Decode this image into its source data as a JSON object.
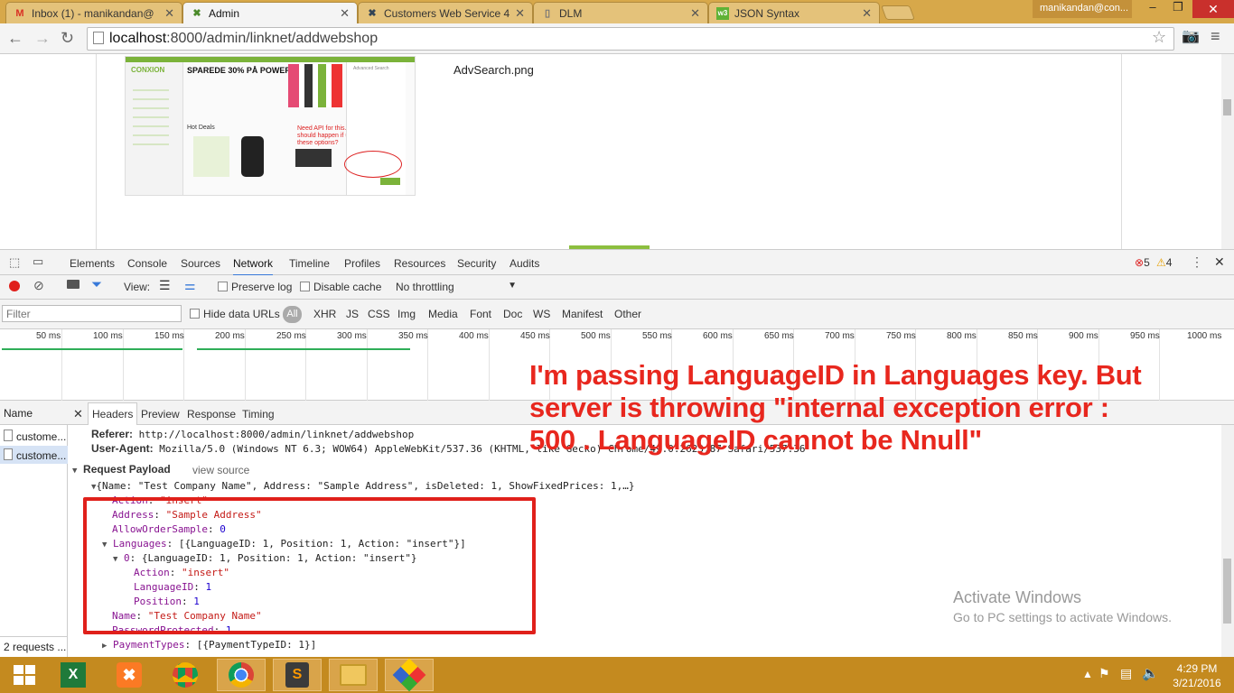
{
  "browser": {
    "tabs": [
      {
        "label": "Inbox (1) - manikandan@",
        "icon": "gmail-icon"
      },
      {
        "label": "Admin",
        "icon": "admin-icon"
      },
      {
        "label": "Customers Web Service 4",
        "icon": "x-icon"
      },
      {
        "label": "DLM",
        "icon": "page-icon"
      },
      {
        "label": "JSON Syntax",
        "icon": "w3-icon"
      }
    ],
    "active_tab": 1,
    "user_label": "manikandan@con...",
    "url_host": "localhost",
    "url_path": ":8000/admin/linknet/addwebshop"
  },
  "page": {
    "file_name": "AdvSearch.png",
    "thumbnail": {
      "brand": "CONXION",
      "banner": "SPAREDE 30% PÅ POWERBANK",
      "hot_deals": "Hot Deals",
      "note": "Need API for this. What should happen if user click these options?",
      "panel_title": "Advanced Search"
    }
  },
  "devtools": {
    "tabs": [
      "Elements",
      "Console",
      "Sources",
      "Network",
      "Timeline",
      "Profiles",
      "Resources",
      "Security",
      "Audits"
    ],
    "selected_tab": "Network",
    "errors": "5",
    "warnings": "4",
    "toolbar": {
      "view_label": "View:",
      "preserve_log": "Preserve log",
      "disable_cache": "Disable cache",
      "throttling": "No throttling"
    },
    "filter": {
      "placeholder": "Filter",
      "hide_data_urls": "Hide data URLs",
      "all": "All",
      "types": [
        "XHR",
        "JS",
        "CSS",
        "Img",
        "Media",
        "Font",
        "Doc",
        "WS",
        "Manifest",
        "Other"
      ]
    },
    "timeline_ticks": [
      "50 ms",
      "100 ms",
      "150 ms",
      "200 ms",
      "250 ms",
      "300 ms",
      "350 ms",
      "400 ms",
      "450 ms",
      "500 ms",
      "550 ms",
      "600 ms",
      "650 ms",
      "700 ms",
      "750 ms",
      "800 ms",
      "850 ms",
      "900 ms",
      "950 ms",
      "1000 ms"
    ],
    "requests": {
      "header": "Name",
      "rows": [
        "custome...",
        "custome..."
      ],
      "footer": "2 requests ..."
    },
    "detail_tabs": [
      "Headers",
      "Preview",
      "Response",
      "Timing"
    ],
    "headers": {
      "referer_key": "Referer:",
      "referer_val": "http://localhost:8000/admin/linknet/addwebshop",
      "ua_key": "User-Agent:",
      "ua_val": "Mozilla/5.0 (Windows NT 6.3; WOW64) AppleWebKit/537.36 (KHTML, like Gecko) Chrome/49.0.2623.87 Safari/537.36",
      "payload_title": "Request Payload",
      "view_source": "view source",
      "summary": "{Name: \"Test Company Name\", Address: \"Sample Address\", isDeleted: 1, ShowFixedPrices: 1,…}"
    },
    "payload": [
      {
        "key": "Action",
        "value": "\"insert\""
      },
      {
        "key": "Address",
        "value": "\"Sample Address\""
      },
      {
        "key": "AllowOrderSample",
        "value": "0"
      },
      {
        "key": "Languages",
        "value": "[{LanguageID: 1, Position: 1, Action: \"insert\"}]"
      },
      {
        "key": "0",
        "value": "{LanguageID: 1, Position: 1, Action: \"insert\"}"
      },
      {
        "key": "Action",
        "value": "\"insert\""
      },
      {
        "key": "LanguageID",
        "value": "1"
      },
      {
        "key": "Position",
        "value": "1"
      },
      {
        "key": "Name",
        "value": "\"Test Company Name\""
      },
      {
        "key": "PasswordProtected",
        "value": "1"
      },
      {
        "key": "PaymentTypes",
        "value": "[{PaymentTypeID: 1}]"
      }
    ]
  },
  "annotation": "I'm passing LanguageID in Languages key. But server is throwing \"internal exception error : 500 . LanguageID cannot be Nnull\"",
  "watermark": {
    "title": "Activate Windows",
    "subtitle": "Go to PC settings to activate Windows."
  },
  "taskbar": {
    "time": "4:29 PM",
    "date": "3/21/2016"
  },
  "colors": {
    "annotation": "#e8271e",
    "highlight_box": "#e0201b",
    "taskbar": "#c48a1f"
  }
}
